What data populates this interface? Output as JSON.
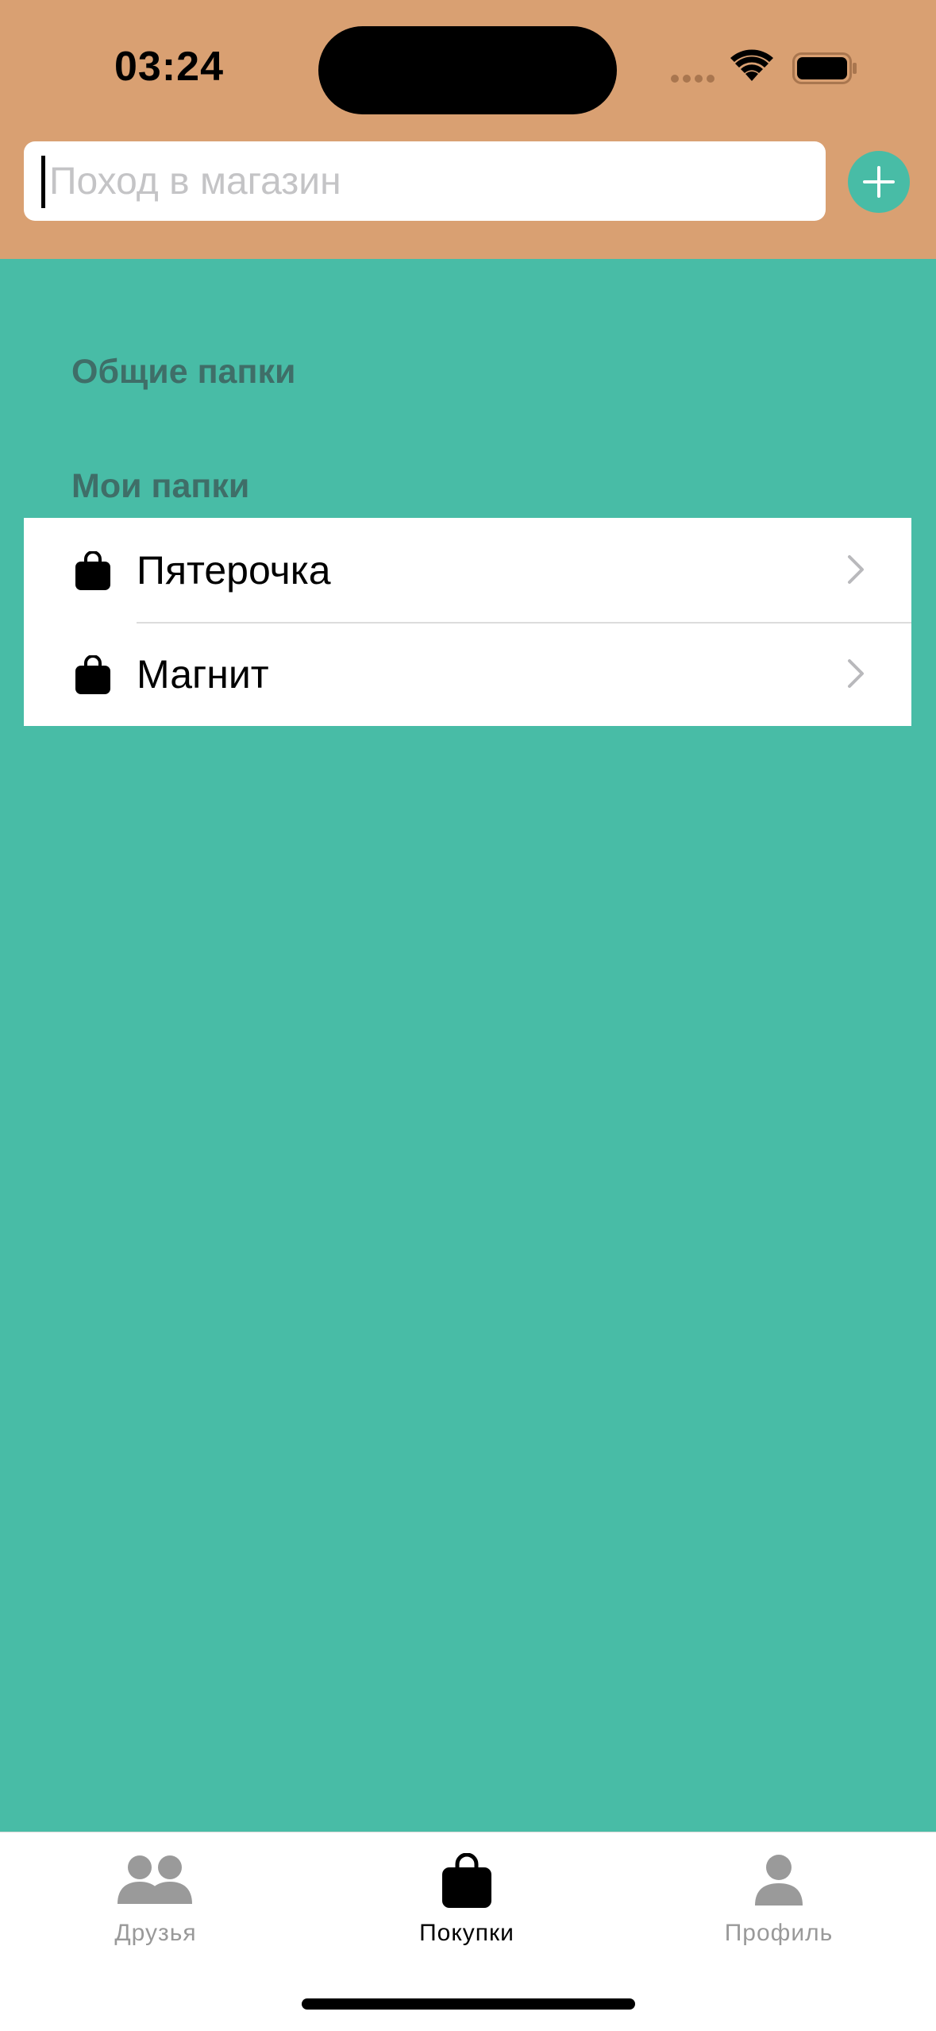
{
  "status_bar": {
    "time": "03:24"
  },
  "search": {
    "placeholder": "Поход в магазин",
    "value": ""
  },
  "sections": {
    "shared_folders": "Общие папки",
    "my_folders": "Мои папки"
  },
  "folders": [
    {
      "name": "Пятерочка",
      "icon": "shopping-bag-icon"
    },
    {
      "name": "Магнит",
      "icon": "shopping-bag-icon"
    }
  ],
  "tabs": [
    {
      "label": "Друзья",
      "icon": "friends-icon",
      "active": false
    },
    {
      "label": "Покупки",
      "icon": "shopping-bag-icon",
      "active": true
    },
    {
      "label": "Профиль",
      "icon": "profile-icon",
      "active": false
    }
  ],
  "colors": {
    "header_bg": "#D9A072",
    "content_bg": "#48BCA6",
    "accent": "#48BCA6"
  }
}
